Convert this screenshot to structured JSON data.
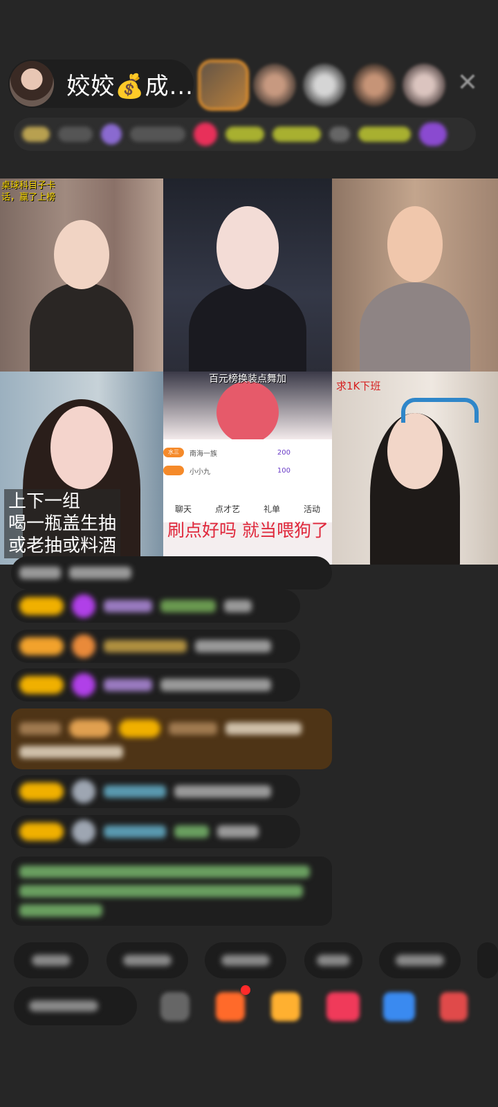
{
  "header": {
    "host_name": "姣姣💰成...",
    "close_glyph": "✕"
  },
  "grid": {
    "tile1_overlay": "桌球科目子卡\n话，赢了上榜",
    "tile5_top_caption": "百元榜换装点舞加",
    "tile6_caption": "求1K下班",
    "tile4_caption_lines": [
      "上下一组",
      "喝一瓶盖生抽",
      "或老抽或料酒"
    ],
    "tile5_red_caption": "刷点好吗 就当喂狗了",
    "tile5_rank": {
      "rows": [
        {
          "badge": "水三",
          "name": "南海一族",
          "score": "200"
        },
        {
          "badge": "",
          "name": "小小九",
          "score": "100"
        }
      ],
      "tabs": [
        "聊天",
        "点才艺",
        "礼单",
        "活动"
      ]
    }
  },
  "colors": {
    "background": "#262626",
    "badge_yellow": "#f0b000",
    "gem_purple": "#b040e8",
    "caption_red": "#e0283c",
    "overlay_yellow": "#f5d400"
  }
}
